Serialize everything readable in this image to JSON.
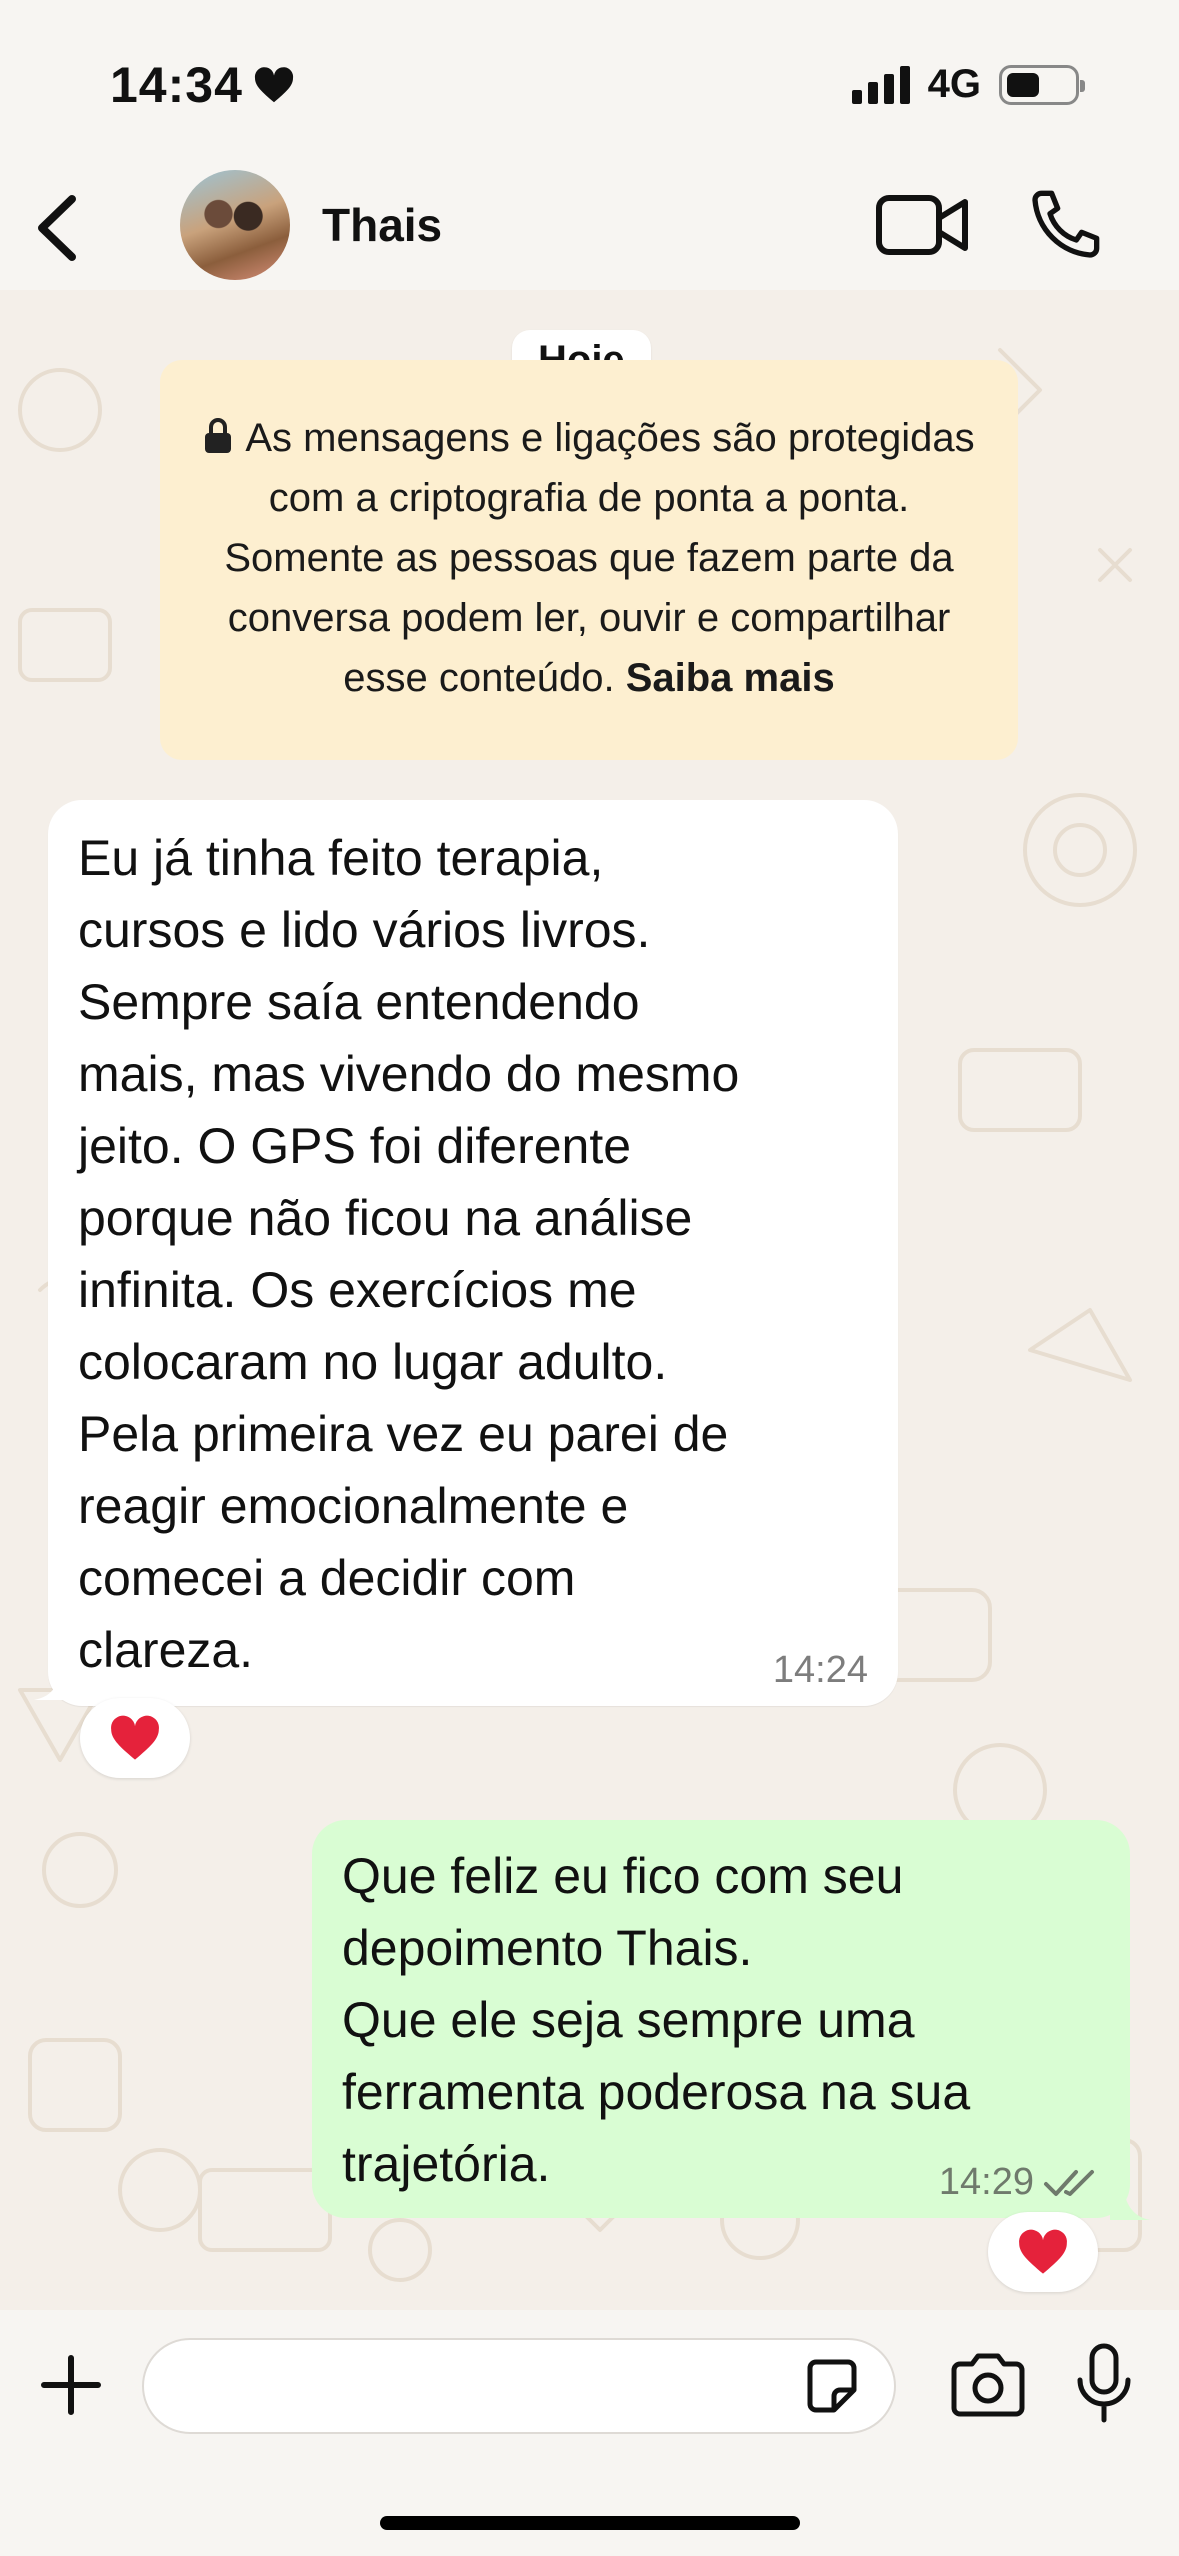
{
  "status_bar": {
    "time": "14:34",
    "network": "4G",
    "battery_level": 0.5
  },
  "header": {
    "contact_name": "Thais",
    "icons": [
      "back-chevron-icon",
      "video-camera-icon",
      "phone-icon"
    ]
  },
  "chat": {
    "date_chip": "Hoje",
    "encryption_notice": {
      "text": "As mensagens e ligações são protegidas com a criptografia de ponta a ponta. Somente as pessoas que fazem parte da conversa podem ler, ouvir e compartilhar esse conteúdo.",
      "link": "Saiba mais"
    },
    "messages": [
      {
        "direction": "incoming",
        "text": "Eu já tinha feito terapia,\ncursos e lido vários livros.\nSempre saía entendendo\nmais, mas vivendo do mesmo\njeito. O GPS foi diferente\nporque não ficou na análise\ninfinita. Os exercícios me\ncolocaram no lugar adulto.\nPela primeira vez eu parei de\nreagir emocionalmente e\ncomecei a decidir com\nclareza.",
        "time": "14:24",
        "reaction": "❤️"
      },
      {
        "direction": "outgoing",
        "text": "Que feliz eu fico com seu\ndepoimento Thais.\nQue ele seja sempre uma\nferramenta poderosa na sua\ntrajetória.",
        "time": "14:29",
        "status": "read",
        "reaction": "❤️"
      }
    ]
  },
  "input_bar": {
    "placeholder": "",
    "value": ""
  },
  "colors": {
    "incoming_bubble": "#ffffff",
    "outgoing_bubble": "#d9fdd3",
    "notice_bg": "#fdefd0",
    "read_ticks": "#6f7a6c",
    "wallpaper": "#f4efe9"
  }
}
